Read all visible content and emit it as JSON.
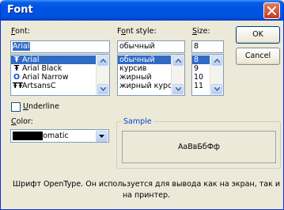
{
  "window": {
    "title": "Font"
  },
  "font": {
    "label_u": "F",
    "label_rest": "ont:",
    "value": "Arial",
    "items": [
      {
        "glyph": "Ŧ",
        "name": "Arial",
        "selected": true
      },
      {
        "glyph": "Ŧ",
        "name": "Arial Black",
        "selected": false
      },
      {
        "glyph": "O",
        "name": "Arial Narrow",
        "selected": false
      },
      {
        "glyph": "ŦŦ",
        "name": "ArtsansC",
        "selected": false
      }
    ]
  },
  "style": {
    "label_pre": "F",
    "label_u": "o",
    "label_rest": "nt style:",
    "value": "обычный",
    "items": [
      {
        "name": "обычный",
        "selected": true
      },
      {
        "name": "курсив",
        "selected": false
      },
      {
        "name": "жирный",
        "selected": false
      },
      {
        "name": "жирный курсив",
        "selected": false
      }
    ]
  },
  "size": {
    "label_u": "S",
    "label_rest": "ize:",
    "value": "8",
    "items": [
      {
        "name": "8",
        "selected": true
      },
      {
        "name": "9",
        "selected": false
      },
      {
        "name": "10",
        "selected": false
      },
      {
        "name": "11",
        "selected": false
      }
    ]
  },
  "buttons": {
    "ok": "OK",
    "cancel": "Cancel"
  },
  "underline": {
    "label_u": "U",
    "label_rest": "nderline",
    "checked": false
  },
  "color": {
    "label_u": "C",
    "label_rest": "olor:",
    "value": "Automatic",
    "swatch_color": "#000000"
  },
  "sample": {
    "label": "Sample",
    "text": "АаВвБбФф"
  },
  "description": "Шрифт OpenType. Он используется для вывода как на экран, так и на принтер.",
  "colors": {
    "title_bar": "#0054e3",
    "selection": "#316ac5",
    "dialog_bg": "#ece9d8"
  }
}
